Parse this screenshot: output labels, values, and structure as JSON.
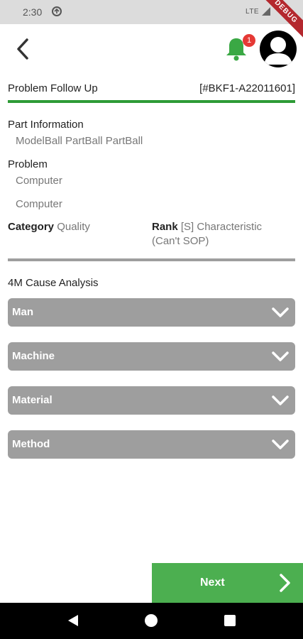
{
  "status_bar": {
    "time": "2:30",
    "network": "LTE",
    "debug_banner": "DEBUG"
  },
  "header": {
    "notification_count": "1"
  },
  "page": {
    "title": "Problem Follow Up",
    "ticket_id": "[#BKF1-A22011601]"
  },
  "part_information": {
    "label": "Part Information",
    "value": "ModelBall PartBall PartBall"
  },
  "problem": {
    "label": "Problem",
    "values": [
      "Computer",
      "Computer"
    ]
  },
  "category": {
    "label": "Category",
    "value": "Quality"
  },
  "rank": {
    "label": "Rank",
    "value_line1": "[S] Characteristic",
    "value_line2": "(Can't SOP)"
  },
  "cause_analysis": {
    "title": "4M Cause Analysis",
    "sections": [
      {
        "label": "Man"
      },
      {
        "label": "Machine"
      },
      {
        "label": "Material"
      },
      {
        "label": "Method"
      }
    ]
  },
  "footer": {
    "next_label": "Next"
  },
  "colors": {
    "accent_green": "#2e9b36",
    "button_green": "#4caf50",
    "accordion_gray": "#9e9e9e",
    "badge_red": "#e53935"
  }
}
